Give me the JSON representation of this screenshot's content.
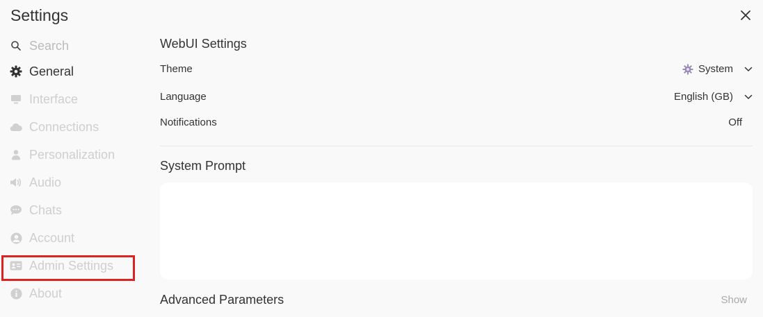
{
  "header": {
    "title": "Settings",
    "close_icon": "close-icon"
  },
  "sidebar": {
    "search": {
      "placeholder": "Search",
      "icon": "search-icon"
    },
    "items": [
      {
        "label": "General",
        "icon": "gear-icon",
        "active": true
      },
      {
        "label": "Interface",
        "icon": "monitor-icon"
      },
      {
        "label": "Connections",
        "icon": "cloud-icon"
      },
      {
        "label": "Personalization",
        "icon": "user-icon"
      },
      {
        "label": "Audio",
        "icon": "speaker-icon"
      },
      {
        "label": "Chats",
        "icon": "chat-bubble-icon"
      },
      {
        "label": "Account",
        "icon": "account-circle-icon"
      },
      {
        "label": "Admin Settings",
        "icon": "id-card-icon",
        "highlighted": true
      },
      {
        "label": "About",
        "icon": "info-icon"
      }
    ],
    "highlight_color": "#dd2222"
  },
  "main": {
    "webui_title": "WebUI Settings",
    "theme": {
      "label": "Theme",
      "value": "System",
      "icon": "system-theme-icon"
    },
    "language": {
      "label": "Language",
      "value": "English (GB)"
    },
    "notifications": {
      "label": "Notifications",
      "value": "Off"
    },
    "system_prompt_title": "System Prompt",
    "system_prompt_value": "",
    "advanced_title": "Advanced Parameters",
    "advanced_toggle": "Show"
  }
}
